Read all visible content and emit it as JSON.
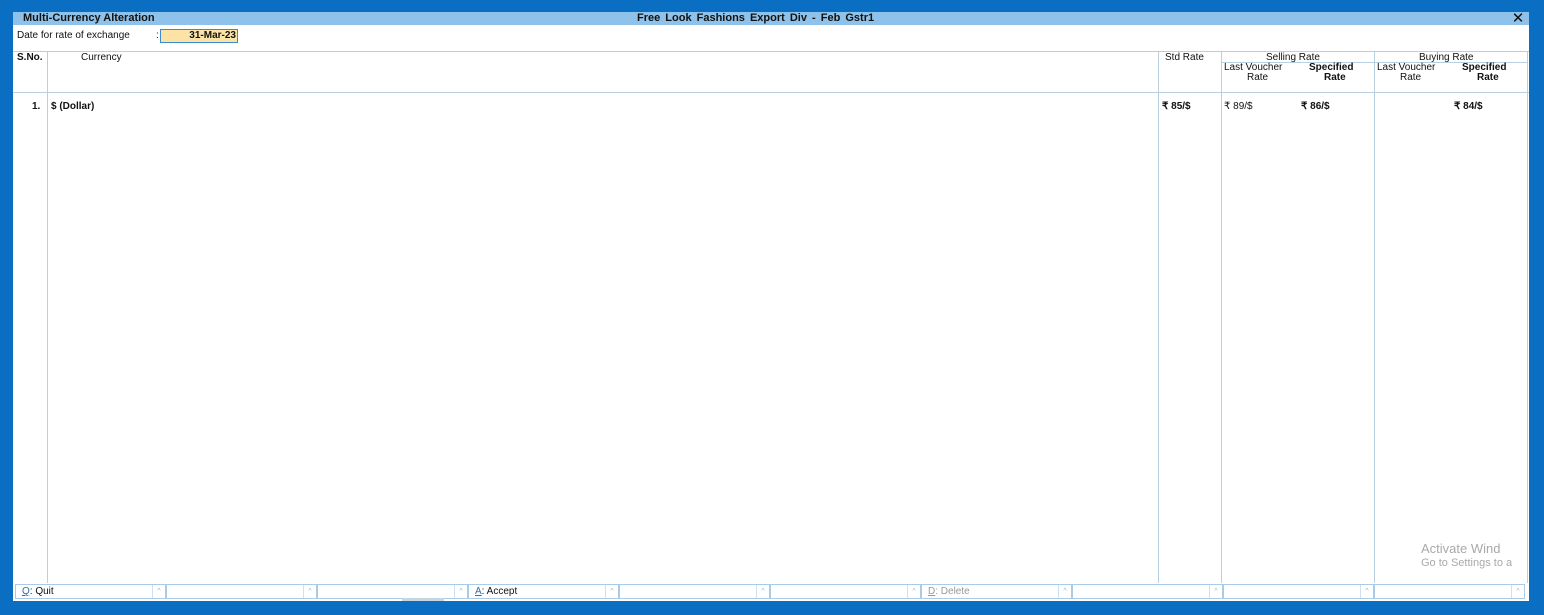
{
  "window": {
    "title_left": "Multi-Currency Alteration",
    "title_center": "Free Look Fashions  Export Div - Feb Gstr1",
    "close_symbol": "✕"
  },
  "date_section": {
    "label": "Date for rate of exchange",
    "colon": ":",
    "value": "31-Mar-23"
  },
  "table": {
    "headers": {
      "sno": "S.No.",
      "currency": "Currency",
      "std_rate": "Std Rate",
      "selling_rate": "Selling Rate",
      "buying_rate": "Buying Rate",
      "last_voucher_1": "Last Voucher",
      "last_voucher_2": "Rate",
      "specified_1": "Specified",
      "specified_2": "Rate"
    },
    "rows": [
      {
        "sno": "1.",
        "currency": "$ (Dollar)",
        "std_rate": "₹ 85/$",
        "selling_last_voucher": "₹ 89/$",
        "selling_specified": "₹ 86/$",
        "buying_last_voucher": "",
        "buying_specified": "₹ 84/$"
      }
    ]
  },
  "watermark": {
    "line1": "Activate Wind",
    "line2": "Go to Settings to a"
  },
  "footer": {
    "buttons": [
      {
        "key": "Q",
        "label": ": Quit",
        "enabled": true
      },
      {
        "key": "",
        "label": "",
        "enabled": true
      },
      {
        "key": "",
        "label": "",
        "enabled": true
      },
      {
        "key": "A",
        "label": ": Accept",
        "enabled": true
      },
      {
        "key": "",
        "label": "",
        "enabled": true
      },
      {
        "key": "",
        "label": "",
        "enabled": true
      },
      {
        "key": "D",
        "label": ": Delete",
        "enabled": false
      },
      {
        "key": "",
        "label": "",
        "enabled": true
      },
      {
        "key": "",
        "label": "",
        "enabled": true
      },
      {
        "key": "",
        "label": "",
        "enabled": true
      }
    ],
    "arrow_symbol": "^"
  },
  "colors": {
    "frame": "#0a6fc2",
    "titlebar": "#8ec2ea",
    "date_field": "#fbe3a6",
    "grid_lines": "#b8cfe0"
  }
}
